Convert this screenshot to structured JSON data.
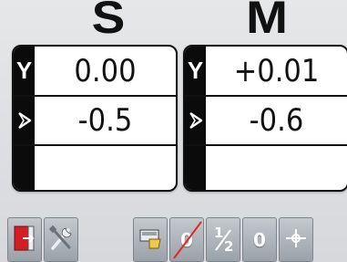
{
  "columns": [
    {
      "id": "s",
      "title": "S",
      "rows": [
        {
          "icon": "y-axis-icon",
          "icon_text": "Y",
          "value": "0.00"
        },
        {
          "icon": "angle-icon",
          "value": "-0.5"
        },
        {
          "icon": "blank",
          "value": ""
        }
      ]
    },
    {
      "id": "m",
      "title": "M",
      "rows": [
        {
          "icon": "y-axis-icon",
          "icon_text": "Y",
          "value": "+0.01"
        },
        {
          "icon": "angle-icon",
          "value": "-0.6"
        },
        {
          "icon": "blank",
          "value": ""
        }
      ]
    }
  ],
  "toolbar": {
    "left": [
      {
        "icon": "exit-door-icon"
      },
      {
        "icon": "tools-icon"
      }
    ],
    "right": [
      {
        "icon": "print-icon"
      },
      {
        "icon": "zero-disabled-icon",
        "text": "0"
      },
      {
        "icon": "half-icon",
        "text_num": "1",
        "text_den": "2"
      },
      {
        "icon": "zero-icon",
        "text": "0"
      },
      {
        "icon": "crosshair-icon"
      }
    ]
  },
  "colors": {
    "background": "#dfe1e4",
    "card_border": "#111111",
    "icon_strip": "#0b0b0b",
    "button": "#aeb4ba",
    "disabled_slash": "#e0262b",
    "door_red": "#d21f26"
  }
}
